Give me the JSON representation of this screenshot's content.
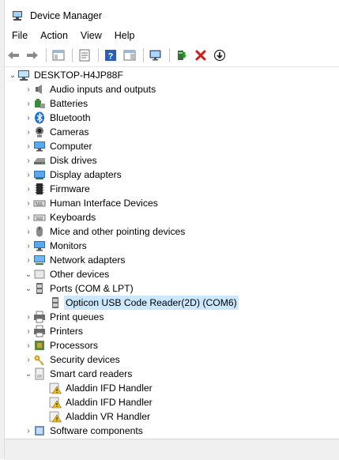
{
  "window": {
    "title": "Device Manager"
  },
  "menu": [
    {
      "label": "File"
    },
    {
      "label": "Action"
    },
    {
      "label": "View"
    },
    {
      "label": "Help"
    }
  ],
  "tree": {
    "root": {
      "label": "DESKTOP-H4JP88F",
      "icon": "computer-icon",
      "expanded": true
    },
    "items": [
      {
        "label": "Audio inputs and outputs",
        "icon": "speaker-icon",
        "expanded": false
      },
      {
        "label": "Batteries",
        "icon": "battery-icon",
        "expanded": false
      },
      {
        "label": "Bluetooth",
        "icon": "bluetooth-icon",
        "expanded": false
      },
      {
        "label": "Cameras",
        "icon": "camera-icon",
        "expanded": false
      },
      {
        "label": "Computer",
        "icon": "monitor-icon",
        "expanded": false
      },
      {
        "label": "Disk drives",
        "icon": "disk-drive-icon",
        "expanded": false
      },
      {
        "label": "Display adapters",
        "icon": "display-adapter-icon",
        "expanded": false
      },
      {
        "label": "Firmware",
        "icon": "firmware-icon",
        "expanded": false
      },
      {
        "label": "Human Interface Devices",
        "icon": "hid-icon",
        "expanded": false
      },
      {
        "label": "Keyboards",
        "icon": "keyboard-icon",
        "expanded": false
      },
      {
        "label": "Mice and other pointing devices",
        "icon": "mouse-icon",
        "expanded": false
      },
      {
        "label": "Monitors",
        "icon": "monitor-icon",
        "expanded": false
      },
      {
        "label": "Network adapters",
        "icon": "network-icon",
        "expanded": false
      },
      {
        "label": "Other devices",
        "icon": "unknown-device-icon",
        "expanded": false
      },
      {
        "label": "Ports (COM & LPT)",
        "icon": "port-icon",
        "expanded": true,
        "children": [
          {
            "label": "Opticon USB Code Reader(2D) (COM6)",
            "icon": "port-icon",
            "selected": true
          }
        ]
      },
      {
        "label": "Print queues",
        "icon": "printer-icon",
        "expanded": false
      },
      {
        "label": "Printers",
        "icon": "printer-icon",
        "expanded": false
      },
      {
        "label": "Processors",
        "icon": "processor-icon",
        "expanded": false
      },
      {
        "label": "Security devices",
        "icon": "key-icon",
        "expanded": false
      },
      {
        "label": "Smart card readers",
        "icon": "smartcard-icon",
        "expanded": true,
        "children": [
          {
            "label": "Aladdin IFD Handler",
            "icon": "warning-icon"
          },
          {
            "label": "Aladdin IFD Handler",
            "icon": "warning-icon"
          },
          {
            "label": "Aladdin VR Handler",
            "icon": "warning-icon"
          }
        ]
      },
      {
        "label": "Software components",
        "icon": "software-icon",
        "expanded": false
      }
    ]
  },
  "colors": {
    "selection": "#cce8ff",
    "accent": "#0078d7",
    "remove": "#d11a1a",
    "warning": "#f2c200"
  }
}
